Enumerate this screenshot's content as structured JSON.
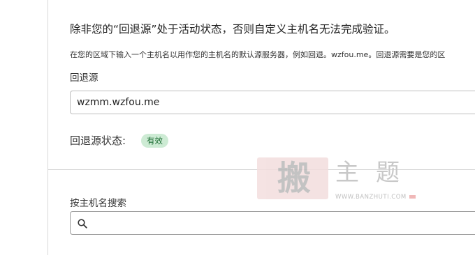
{
  "origin_section": {
    "heading": "除非您的“回退源”处于活动状态，否则自定义主机名无法完成验证。",
    "description": "在您的区域下输入一个主机名以用作您的主机名的默认源服务器，例如回退。wzfou.me。回退源需要是您的区",
    "field_label": "回退源",
    "field_value": "wzmm.wzfou.me",
    "status_label": "回退源状态:",
    "status_value": "有效",
    "status_color": "#cdebd4"
  },
  "hostname_search": {
    "label": "按主机名搜索",
    "placeholder": "",
    "icon": "search-icon"
  },
  "watermark": {
    "seal_char": "搬",
    "title": "主题",
    "url": "WWW.BANZHUTI.COM"
  }
}
